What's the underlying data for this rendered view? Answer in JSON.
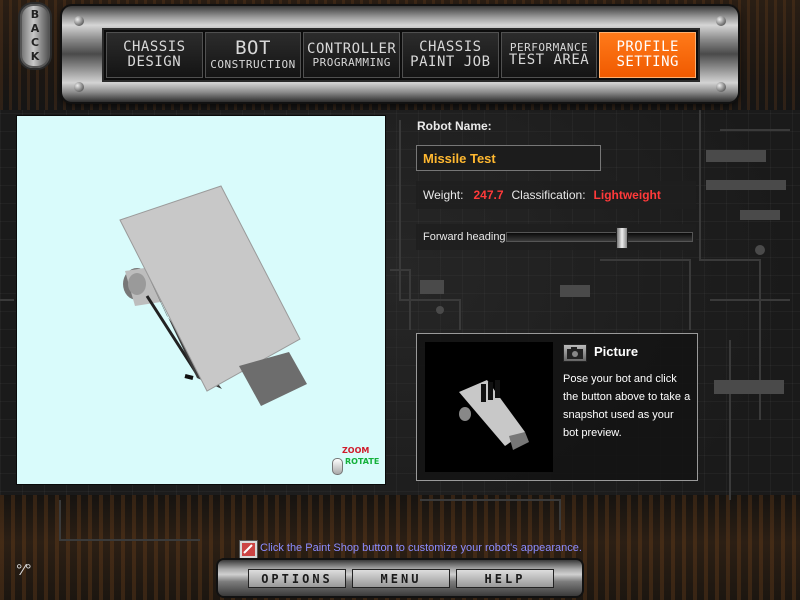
{
  "nav": {
    "back_label": "BACK",
    "tabs": [
      {
        "line1": "CHASSIS",
        "line2": "DESIGN",
        "active": false
      },
      {
        "line1": "BOT",
        "line2": "CONSTRUCTION",
        "active": false
      },
      {
        "line1": "CONTROLLER",
        "line2": "PROGRAMMING",
        "active": false
      },
      {
        "line1": "CHASSIS",
        "line2": "PAINT JOB",
        "active": false
      },
      {
        "line1": "PERFORMANCE",
        "line2": "TEST AREA",
        "active": false
      },
      {
        "line1": "PROFILE",
        "line2": "SETTING",
        "active": true
      }
    ]
  },
  "preview": {
    "zoom_label": "ZOOM",
    "rotate_label": "ROTATE"
  },
  "profile": {
    "robot_name_label": "Robot Name:",
    "robot_name_value": "Missile Test",
    "weight_label": "Weight:",
    "weight_value": "247.7",
    "classification_label": "Classification:",
    "classification_value": "Lightweight",
    "forward_heading_label": "Forward heading:",
    "forward_heading_fraction": 0.63
  },
  "picture": {
    "title": "Picture",
    "description": "Pose your bot and click the button above to take a snapshot used as your bot preview."
  },
  "tip": {
    "text": "Click the Paint Shop button to customize your robot's appearance."
  },
  "bottom_bar": {
    "options_label": "OPTIONS",
    "menu_label": "MENU",
    "help_label": "HELP"
  },
  "colors": {
    "active_tab": "#f05a00",
    "robot_name_text": "#ffb830",
    "stat_value": "#ff3a3a",
    "tip_text": "#8c8cff",
    "preview_bg": "#d9fbfb"
  }
}
